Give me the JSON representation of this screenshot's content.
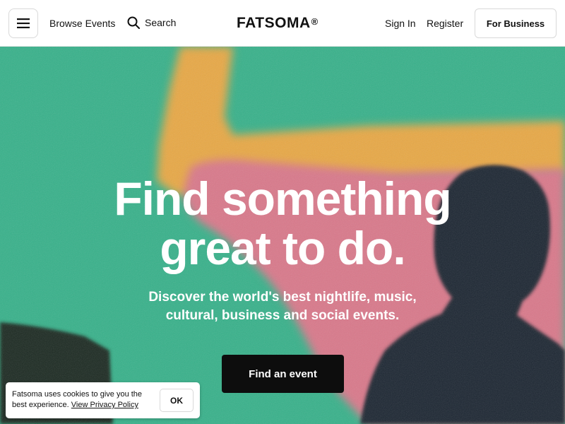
{
  "header": {
    "browse_label": "Browse Events",
    "search_label": "Search",
    "logo": "FATSOMA",
    "logo_mark": "®",
    "sign_in_label": "Sign In",
    "register_label": "Register",
    "business_label": "For Business"
  },
  "hero": {
    "headline_line1": "Find something",
    "headline_line2": "great to do.",
    "sub_line1": "Discover the world's best nightlife, music,",
    "sub_line2": "cultural, business and social events.",
    "cta_label": "Find an event"
  },
  "cookie": {
    "text": "Fatsoma uses cookies to give you the best experience.",
    "link_label": "View Privacy Policy",
    "ok_label": "OK"
  },
  "colors": {
    "hero_green": "#37b18a",
    "hero_orange": "#e8a844",
    "hero_pink": "#d9788a",
    "cta_bg": "#0d0d0d"
  },
  "icons": [
    "hamburger-menu-icon",
    "search-icon"
  ]
}
